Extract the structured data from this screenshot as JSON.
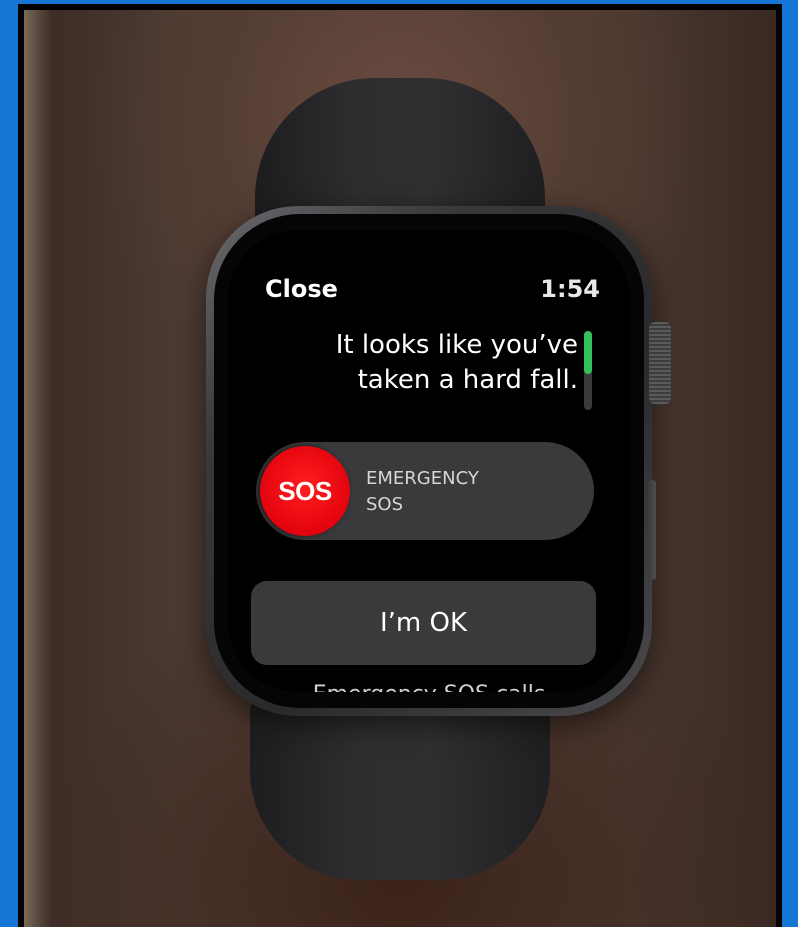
{
  "watch": {
    "status": {
      "close_label": "Close",
      "time": "1:54"
    },
    "alert": {
      "message_line1": "It looks like you’ve",
      "message_line2": "taken a hard fall."
    },
    "scroll_indicator": {
      "position_fraction": 0.0,
      "visible_fraction": 0.55,
      "color": "#35c05a"
    },
    "sos_slider": {
      "knob_label": "SOS",
      "label_line1": "EMERGENCY",
      "label_line2": "SOS",
      "knob_color": "#e3030e"
    },
    "ok_button": {
      "label": "I’m OK"
    },
    "footer": {
      "partial_text": "Emergency SOS calls"
    }
  }
}
